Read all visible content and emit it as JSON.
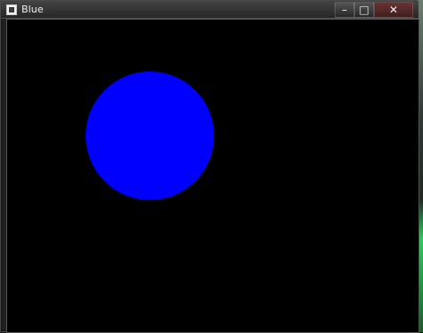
{
  "window": {
    "title": "Blue",
    "controls": {
      "minimize_icon": "minimize-icon",
      "maximize_icon": "maximize-icon",
      "close_icon": "close-icon"
    }
  },
  "canvas": {
    "background_color": "#000000",
    "shapes": [
      {
        "type": "circle",
        "fill_color": "#0000ff"
      }
    ]
  }
}
